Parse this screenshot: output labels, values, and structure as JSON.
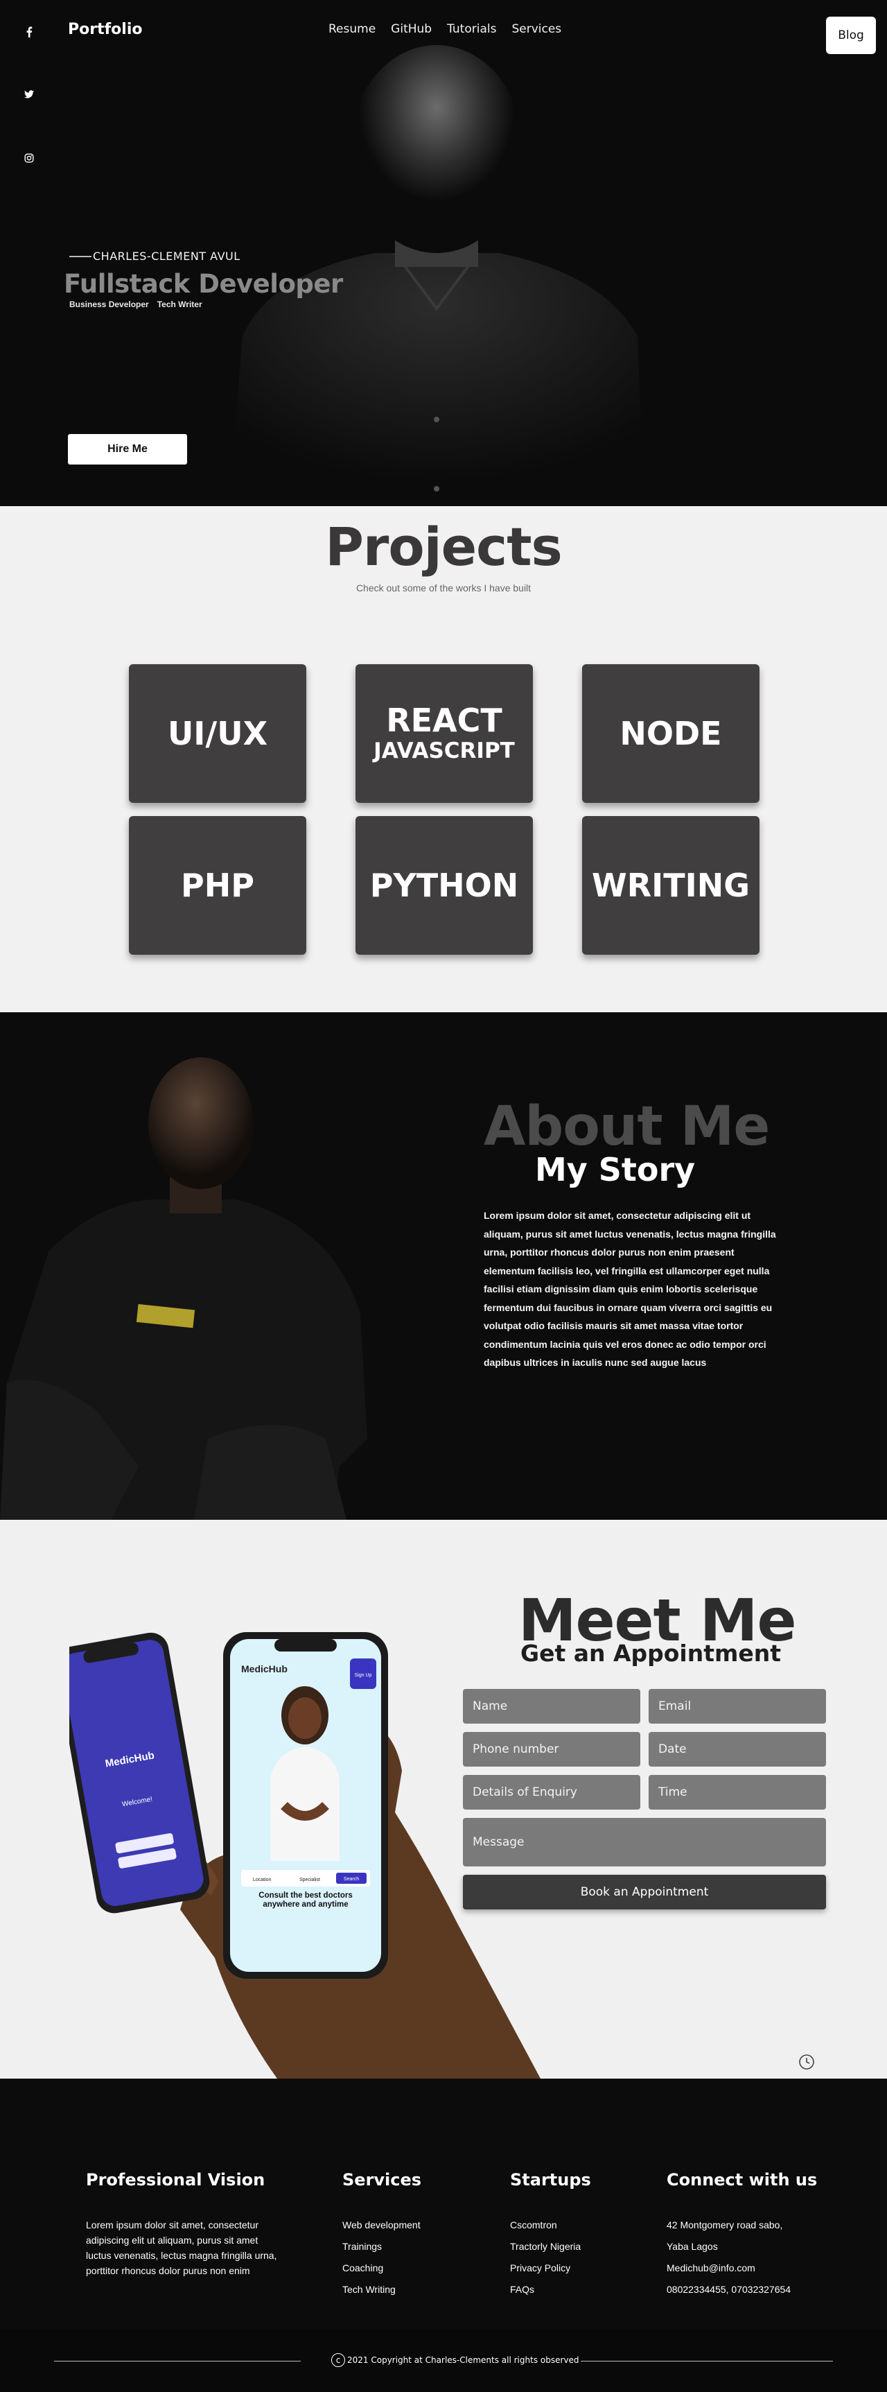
{
  "header": {
    "brand": "Portfolio",
    "nav": [
      "Resume",
      "GitHub",
      "Tutorials",
      "Services"
    ],
    "blog_label": "Blog",
    "social_icons": [
      "facebook-icon",
      "twitter-icon",
      "instagram-icon"
    ]
  },
  "hero": {
    "name": "CHARLES-CLEMENT AVUL",
    "title": "Fullstack Developer",
    "tags": [
      "Business Developer",
      "Tech Writer"
    ],
    "hire_label": "Hire Me"
  },
  "projects": {
    "title": "Projects",
    "subtitle": "Check out some of the works I have built",
    "cards": [
      {
        "main": "UI/UX",
        "sub": ""
      },
      {
        "main": "REACT",
        "sub": "JAVASCRIPT"
      },
      {
        "main": "NODE",
        "sub": ""
      },
      {
        "main": "PHP",
        "sub": ""
      },
      {
        "main": "PYTHON",
        "sub": ""
      },
      {
        "main": "WRITING",
        "sub": ""
      }
    ]
  },
  "about": {
    "title": "About Me",
    "subtitle": "My Story",
    "text": "Lorem ipsum dolor sit amet, consectetur adipiscing elit ut aliquam, purus sit amet luctus venenatis, lectus magna fringilla urna, porttitor rhoncus dolor purus non enim praesent elementum facilisis leo, vel fringilla est ullamcorper eget nulla facilisi etiam dignissim diam quis enim lobortis scelerisque fermentum dui faucibus in ornare quam viverra orci sagittis eu volutpat odio facilisis mauris sit amet massa vitae tortor condimentum lacinia quis vel eros donec ac odio tempor orci dapibus ultrices in iaculis nunc sed augue lacus"
  },
  "meet": {
    "title": "Meet Me",
    "subtitle": "Get an Appointment",
    "fields": {
      "name": "Name",
      "email": "Email",
      "phone": "Phone number",
      "date": "Date",
      "details": "Details of Enquiry",
      "time": "Time",
      "message": "Message"
    },
    "book_label": "Book an Appointment",
    "phone_mockup": {
      "app_name": "MedicHub",
      "signup": "Sign Up",
      "location": "Location",
      "specialist": "Specialist",
      "search": "Search",
      "headline": "Consult the best doctors anywhere and anytime",
      "welcome": "Welcome!"
    }
  },
  "footer": {
    "vision": {
      "title": "Professional Vision",
      "text": "Lorem ipsum dolor sit amet, consectetur adipiscing elit ut aliquam, purus sit amet luctus venenatis, lectus magna fringilla urna, porttitor rhoncus dolor purus non enim"
    },
    "services": {
      "title": "Services",
      "items": [
        "Web development",
        "Trainings",
        "Coaching",
        "Tech Writing"
      ]
    },
    "startups": {
      "title": "Startups",
      "items": [
        "Cscomtron",
        "Tractorly Nigeria",
        "Privacy Policy",
        "FAQs"
      ]
    },
    "connect": {
      "title": "Connect with us",
      "items": [
        "42 Montgomery road sabo,",
        "Yaba Lagos",
        "Medichub@info.com",
        "08022334455, 07032327654"
      ]
    },
    "copyright": "2021 Copyright  at Charles-Clements all rights observed"
  }
}
